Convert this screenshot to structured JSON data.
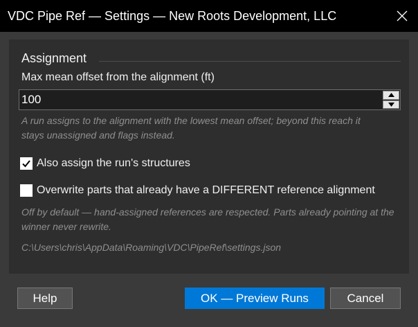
{
  "window": {
    "title": "VDC Pipe Ref — Settings — New Roots Development, LLC"
  },
  "assignment": {
    "group_label": "Assignment",
    "offset_label": "Max mean offset from the alignment (ft)",
    "offset_value": "100",
    "offset_hint": "A run assigns to the alignment with the lowest mean offset; beyond this reach it stays unassigned and flags instead.",
    "assign_structures": {
      "label": "Also assign the run's structures",
      "checked": true
    },
    "overwrite_parts": {
      "label": "Overwrite parts that already have a DIFFERENT reference alignment",
      "checked": false
    },
    "overwrite_hint": "Off by default — hand-assigned references are respected. Parts already pointing at the winner never rewrite.",
    "settings_path": "C:\\Users\\chris\\AppData\\Roaming\\VDC\\PipeRef\\settings.json"
  },
  "buttons": {
    "help": "Help",
    "ok": "OK — Preview Runs",
    "cancel": "Cancel"
  },
  "colors": {
    "titlebar": "#000000",
    "dialog_bg": "#3a3a3a",
    "panel_bg": "#2e2e2e",
    "accent": "#0078d7",
    "hint_text": "#8f8f8f"
  },
  "icons": {
    "close": "close-icon",
    "spin_up": "chevron-up-icon",
    "spin_down": "chevron-down-icon",
    "check": "checkmark-icon"
  }
}
